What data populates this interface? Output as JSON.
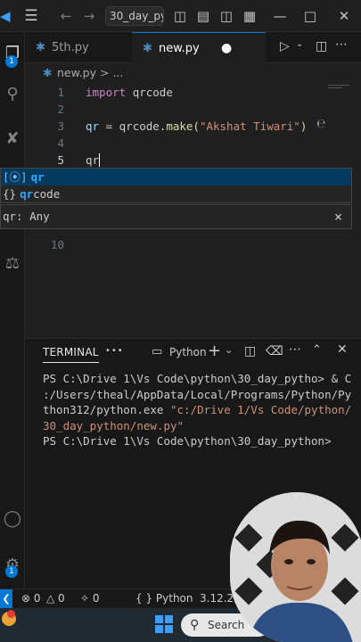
{
  "titlebar": {
    "search_text": "30_day_pyt",
    "icons": [
      "app-menu-icon",
      "back-arrow-icon",
      "forward-arrow-icon",
      "layout-sidebar-icon",
      "layout-panel-icon",
      "layout-secondary-icon",
      "customize-layout-icon",
      "minimize-icon",
      "maximize-icon",
      "close-icon"
    ]
  },
  "activity": {
    "explorer_badge": "1",
    "accounts_badge": "1"
  },
  "tabs": [
    {
      "label": "5th.py",
      "active": false
    },
    {
      "label": "new.py",
      "active": true
    }
  ],
  "breadcrumb": {
    "file": "new.py",
    "sep": ">",
    "more": "..."
  },
  "editor": {
    "lines": [
      {
        "n": "1"
      },
      {
        "n": "2"
      },
      {
        "n": "3"
      },
      {
        "n": "4"
      },
      {
        "n": "5"
      },
      {
        "n": "10"
      }
    ],
    "line1": {
      "kw": "import",
      "mod": "qrcode"
    },
    "line3": {
      "var": "qr",
      "eq": " = ",
      "obj": "qrcode",
      "fn": ".make(",
      "str": "\"Akshat Tiwari\"",
      "close": ")"
    },
    "line5": {
      "typed": "qr"
    }
  },
  "suggest": {
    "items": [
      {
        "icon": "[⦿]",
        "match": "qr",
        "rest": ""
      },
      {
        "icon": "{}",
        "match": "qr",
        "rest": "code"
      }
    ]
  },
  "hover": {
    "text": "qr: Any",
    "close": "×"
  },
  "terminal": {
    "tab_label": "TERMINAL",
    "more": "•••",
    "shell_label": "Python",
    "lines": [
      "PS C:\\Drive 1\\Vs Code\\python\\30_day_pytho> & C",
      ":/Users/theal/AppData/Local/Programs/Python/Py",
      "thon312/python.exe "
    ],
    "quoted1": "\"c:/Drive 1/Vs Code/python/",
    "quoted2": "30_day_python/new.py\"",
    "prompt": "PS C:\\Drive 1\\Vs Code\\python\\30_day_python>"
  },
  "status": {
    "errors": "0",
    "warnings": "0",
    "ports": "0",
    "language": "Python",
    "version": "3.12.2 6"
  },
  "taskbar": {
    "search_placeholder": "Search"
  }
}
